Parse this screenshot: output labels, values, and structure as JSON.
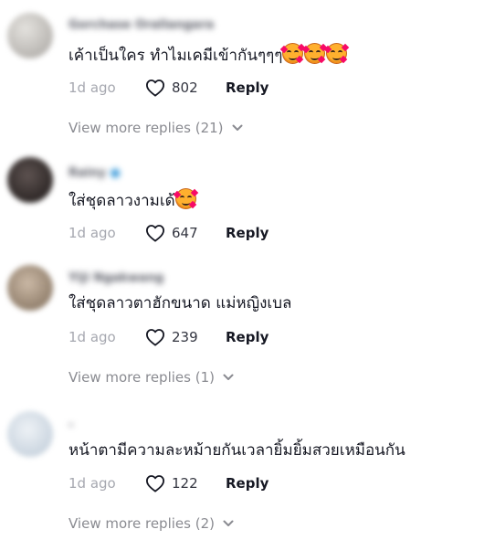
{
  "comments": [
    {
      "username": "Gorchase Orallangara",
      "avatar_color": "#c9c7c4",
      "text": "เค้าเป็นใคร ทำไมเคมีเข้ากันๆๆๆ",
      "emojis": [
        "smiling-face-with-hearts-icon",
        "smiling-face-with-hearts-icon",
        "smiling-face-with-hearts-icon"
      ],
      "time": "1d ago",
      "likes": "802",
      "reply_label": "Reply",
      "more_replies": "View more replies (21)"
    },
    {
      "username": "Rainy",
      "avatar_color": "#3b3432",
      "text": "ใส่ชุดลาวงามเด้",
      "emojis": [
        "smiling-face-with-hearts-icon"
      ],
      "time": "1d ago",
      "likes": "647",
      "reply_label": "Reply",
      "more_replies": ""
    },
    {
      "username": "Yiji Ngakwang",
      "avatar_color": "#b19f8c",
      "text": "ใส่ชุดลาวตาฮักขนาด แม่หญิงเบล",
      "emojis": [],
      "time": "1d ago",
      "likes": "239",
      "reply_label": "Reply",
      "more_replies": "View more replies (1)"
    },
    {
      "username": "-",
      "avatar_color": "#dde6f0",
      "text": "หน้าตามีความละหม้ายกันเวลายิ้มยิ้มสวยเหมือนกัน",
      "emojis": [],
      "time": "1d ago",
      "likes": "122",
      "reply_label": "Reply",
      "more_replies": "View more replies (2)"
    }
  ]
}
